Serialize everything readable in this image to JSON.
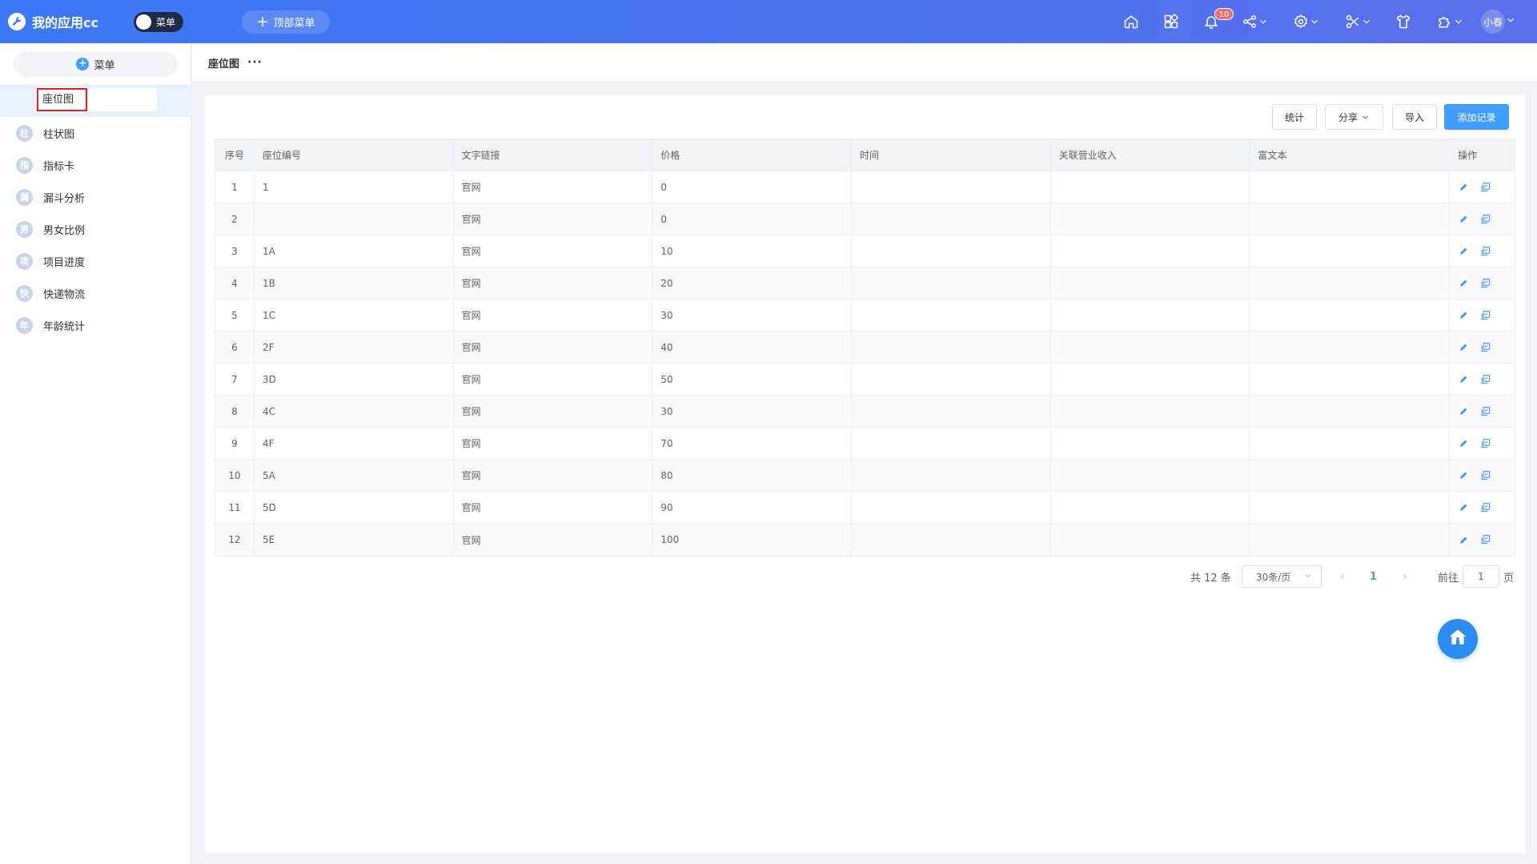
{
  "header": {
    "app_title": "我的应用cc",
    "menu_toggle_label": "菜单",
    "top_menu_label": "顶部菜单",
    "notification_count": "10",
    "user_name": "小春"
  },
  "sidebar": {
    "add_menu_label": "菜单",
    "rename_value": "座位图",
    "items": [
      {
        "icon_char": "柱",
        "label": "柱状图"
      },
      {
        "icon_char": "指",
        "label": "指标卡"
      },
      {
        "icon_char": "漏",
        "label": "漏斗分析"
      },
      {
        "icon_char": "男",
        "label": "男女比例"
      },
      {
        "icon_char": "项",
        "label": "项目进度"
      },
      {
        "icon_char": "快",
        "label": "快递物流"
      },
      {
        "icon_char": "年",
        "label": "年龄统计"
      }
    ]
  },
  "breadcrumb": {
    "title": "座位图",
    "more": "···"
  },
  "toolbar": {
    "stats_label": "统计",
    "share_label": "分享",
    "import_label": "导入",
    "add_label": "添加记录"
  },
  "table": {
    "columns": [
      "序号",
      "座位编号",
      "文字链接",
      "价格",
      "时间",
      "关联营业收入",
      "富文本",
      "操作"
    ],
    "rows": [
      {
        "no": "1",
        "seat": "1",
        "link": "官网",
        "price": "0"
      },
      {
        "no": "2",
        "seat": "",
        "link": "官网",
        "price": "0"
      },
      {
        "no": "3",
        "seat": "1A",
        "link": "官网",
        "price": "10"
      },
      {
        "no": "4",
        "seat": "1B",
        "link": "官网",
        "price": "20"
      },
      {
        "no": "5",
        "seat": "1C",
        "link": "官网",
        "price": "30"
      },
      {
        "no": "6",
        "seat": "2F",
        "link": "官网",
        "price": "40"
      },
      {
        "no": "7",
        "seat": "3D",
        "link": "官网",
        "price": "50"
      },
      {
        "no": "8",
        "seat": "4C",
        "link": "官网",
        "price": "30"
      },
      {
        "no": "9",
        "seat": "4F",
        "link": "官网",
        "price": "70"
      },
      {
        "no": "10",
        "seat": "5A",
        "link": "官网",
        "price": "80"
      },
      {
        "no": "11",
        "seat": "5D",
        "link": "官网",
        "price": "90"
      },
      {
        "no": "12",
        "seat": "5E",
        "link": "官网",
        "price": "100"
      }
    ]
  },
  "pagination": {
    "total_text": "共 12 条",
    "page_size": "30条/页",
    "current_page": "1",
    "goto_label": "前往",
    "goto_value": "1",
    "page_suffix": "页"
  },
  "icons": {
    "brand": "wrench-icon",
    "home": "home-icon",
    "apps": "grid-icon",
    "bell": "bell-icon",
    "share": "share-icon",
    "settings": "gear-icon",
    "tools": "scissors-icon",
    "theme": "shirt-icon",
    "plugin": "puzzle-icon",
    "fab": "home-fab-icon"
  },
  "colors": {
    "header_start": "#3b79f6",
    "header_end": "#5b70ec",
    "primary": "#409eff",
    "badge": "#f56c6c",
    "highlight_border": "#e02020"
  }
}
